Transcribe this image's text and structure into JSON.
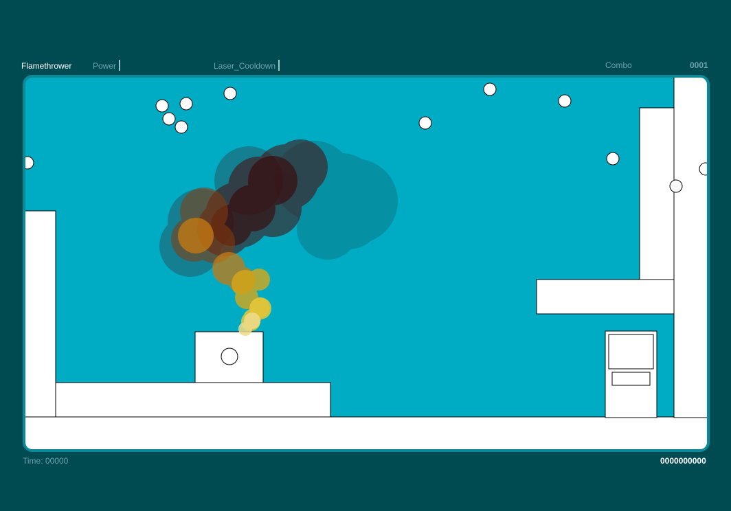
{
  "hud": {
    "weapon": "Flamethrower",
    "power_label": "Power",
    "laser_label": "Laser_Cooldown",
    "combo_label": "Combo",
    "combo_count": "0001",
    "time_text": "Time: 00000",
    "score_text": "0000000000"
  },
  "colors": {
    "background": "#004a52",
    "arena_fill": "#00acc4",
    "arena_border": "#0a8a98",
    "platform": "#ffffff",
    "smoke_dark": "#4a0a08",
    "fire_orange": "#c87a10",
    "fire_yellow": "#e8c030"
  },
  "icons": {
    "enemy_ball": "white-circle",
    "player": "white-circle-outlined"
  }
}
